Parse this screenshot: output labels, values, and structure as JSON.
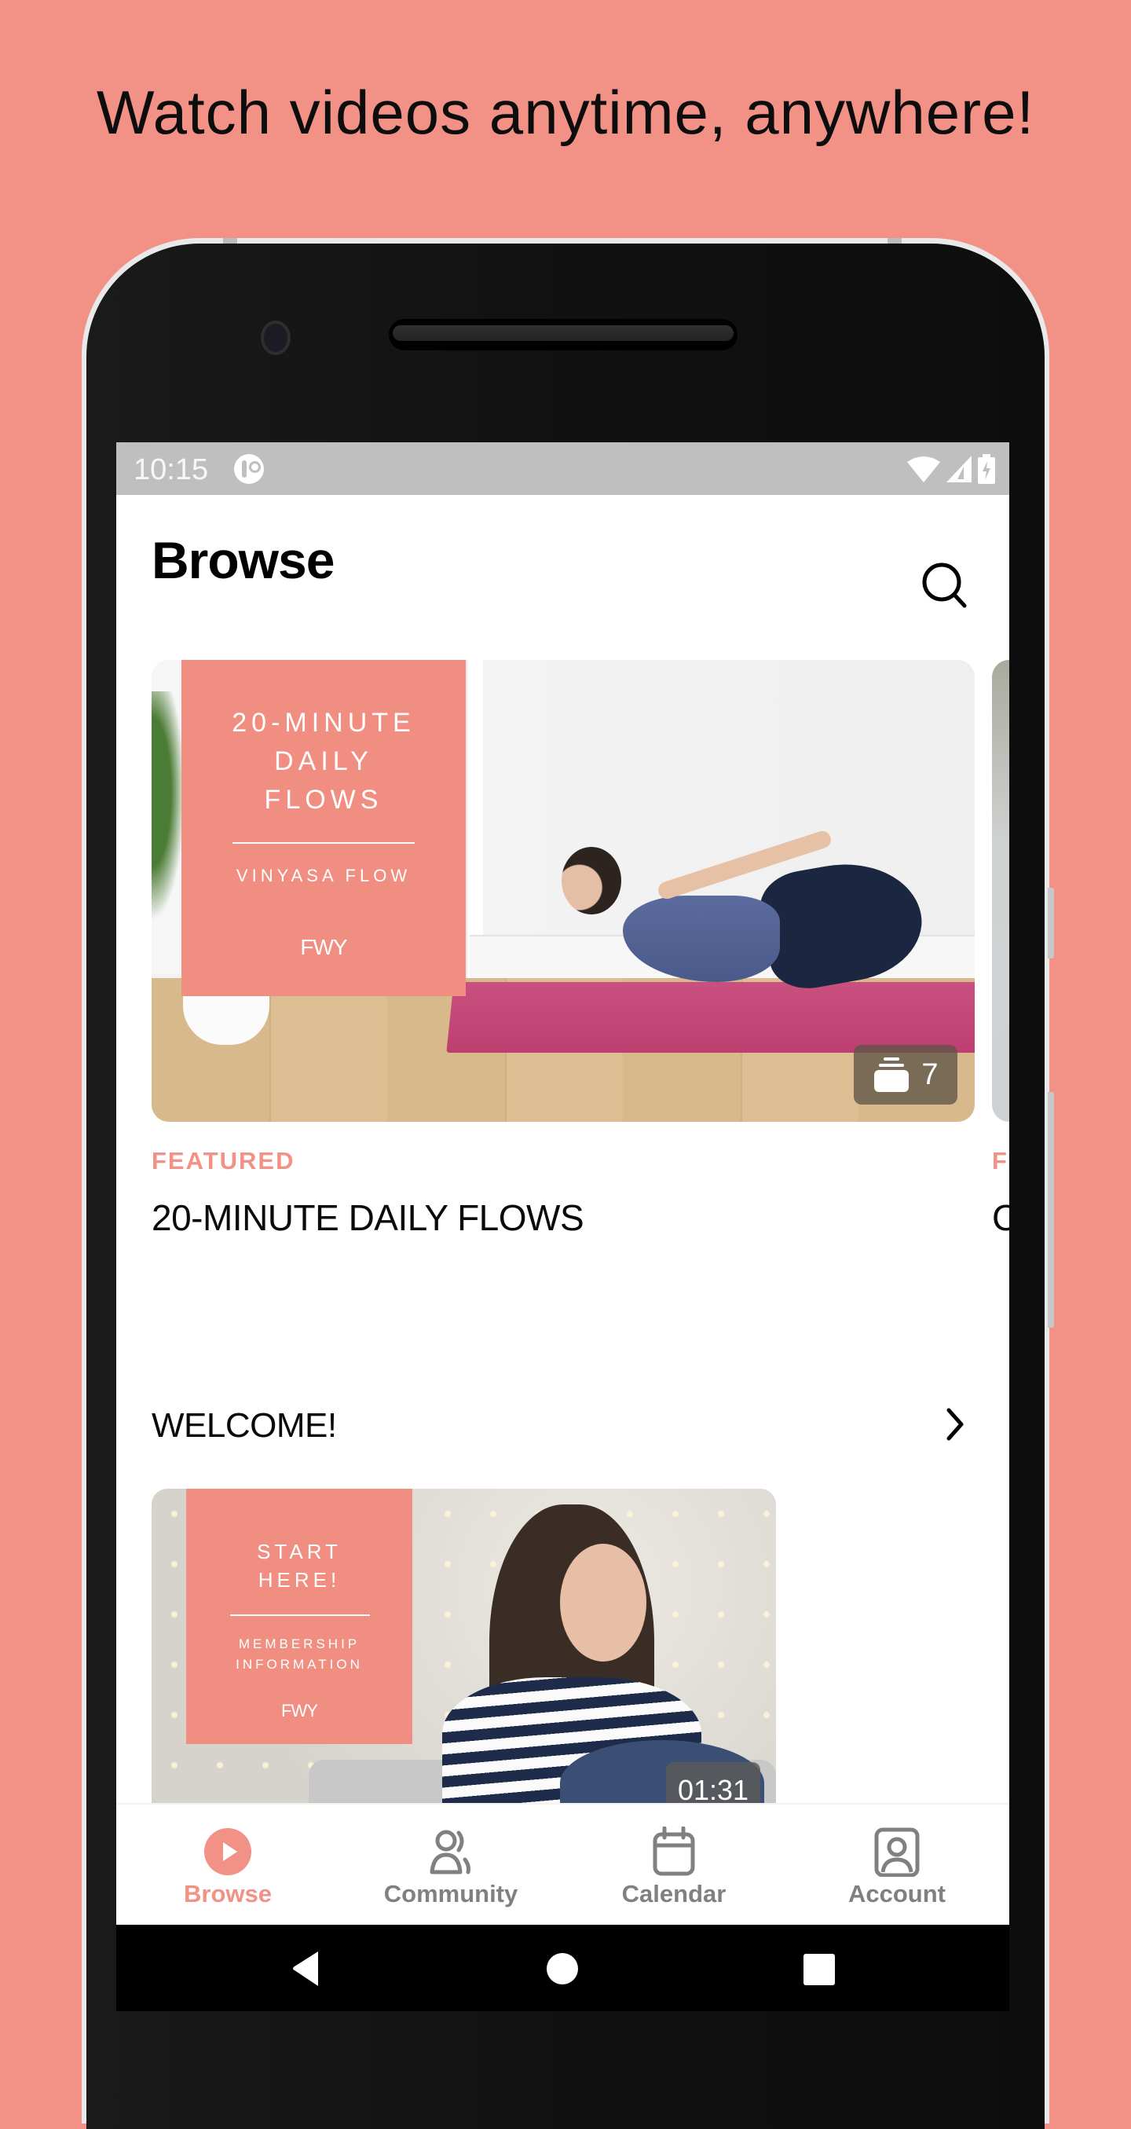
{
  "promo": {
    "headline": "Watch videos anytime, anywhere!"
  },
  "colors": {
    "accent": "#F29185",
    "background": "#F29185",
    "nav_inactive": "#808080",
    "status_bar": "#BFBFBF"
  },
  "status_bar": {
    "time": "10:15",
    "icons": [
      "app-notification-icon",
      "wifi-icon",
      "signal-icon",
      "battery-charging-icon"
    ]
  },
  "header": {
    "title": "Browse",
    "search_icon": "search-icon"
  },
  "featured": {
    "items": [
      {
        "eyebrow": "FEATURED",
        "title": "20-MINUTE DAILY FLOWS",
        "cover": {
          "title_lines": [
            "20-MINUTE",
            "DAILY",
            "FLOWS"
          ],
          "subtitle": "VINYASA FLOW",
          "logo": "FWY"
        },
        "video_count": "7",
        "badge_icon": "stack-icon"
      },
      {
        "eyebrow": "F",
        "title": "C"
      }
    ]
  },
  "sections": [
    {
      "title": "WELCOME!",
      "chevron_icon": "chevron-right-icon",
      "items": [
        {
          "cover": {
            "title_lines": [
              "START",
              "HERE!"
            ],
            "subtitle_lines": [
              "MEMBERSHIP",
              "INFORMATION"
            ],
            "logo": "FWY"
          },
          "duration": "01:31"
        }
      ]
    }
  ],
  "bottom_nav": {
    "items": [
      {
        "label": "Browse",
        "icon": "play-circle-icon",
        "active": true
      },
      {
        "label": "Community",
        "icon": "users-icon",
        "active": false
      },
      {
        "label": "Calendar",
        "icon": "calendar-icon",
        "active": false
      },
      {
        "label": "Account",
        "icon": "account-icon",
        "active": false
      }
    ]
  },
  "system_nav": {
    "buttons": [
      "back-icon",
      "home-icon",
      "recents-icon"
    ]
  }
}
